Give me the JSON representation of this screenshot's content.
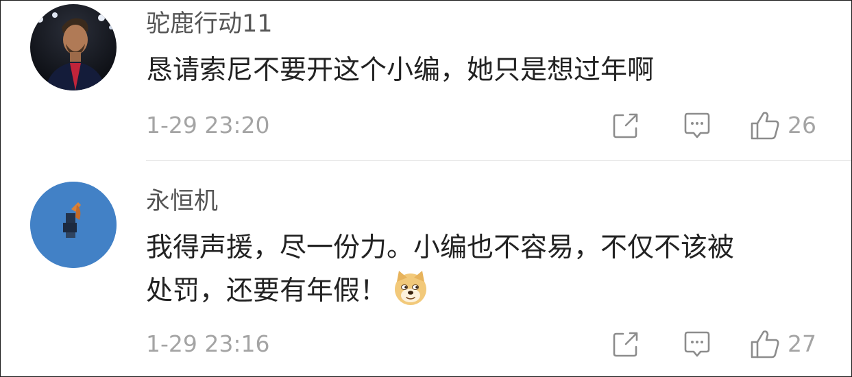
{
  "comments": [
    {
      "username": "驼鹿行动11",
      "text": "恳请索尼不要开这个小编，她只是想过年啊",
      "time": "1-29 23:20",
      "likes": "26",
      "avatar_icon": "football-player-avatar"
    },
    {
      "username": "永恒机",
      "text": "我得声援，尽一份力。小编也不容易，不仅不该被\n处罚，还要有年假！",
      "time": "1-29 23:16",
      "likes": "27",
      "avatar_icon": "blue-circle-figure-avatar",
      "emoji_icon": "doge-emoji"
    }
  ],
  "colors": {
    "username": "#555555",
    "text": "#222222",
    "meta": "#a4a4a4",
    "divider": "#e2e2e2"
  }
}
